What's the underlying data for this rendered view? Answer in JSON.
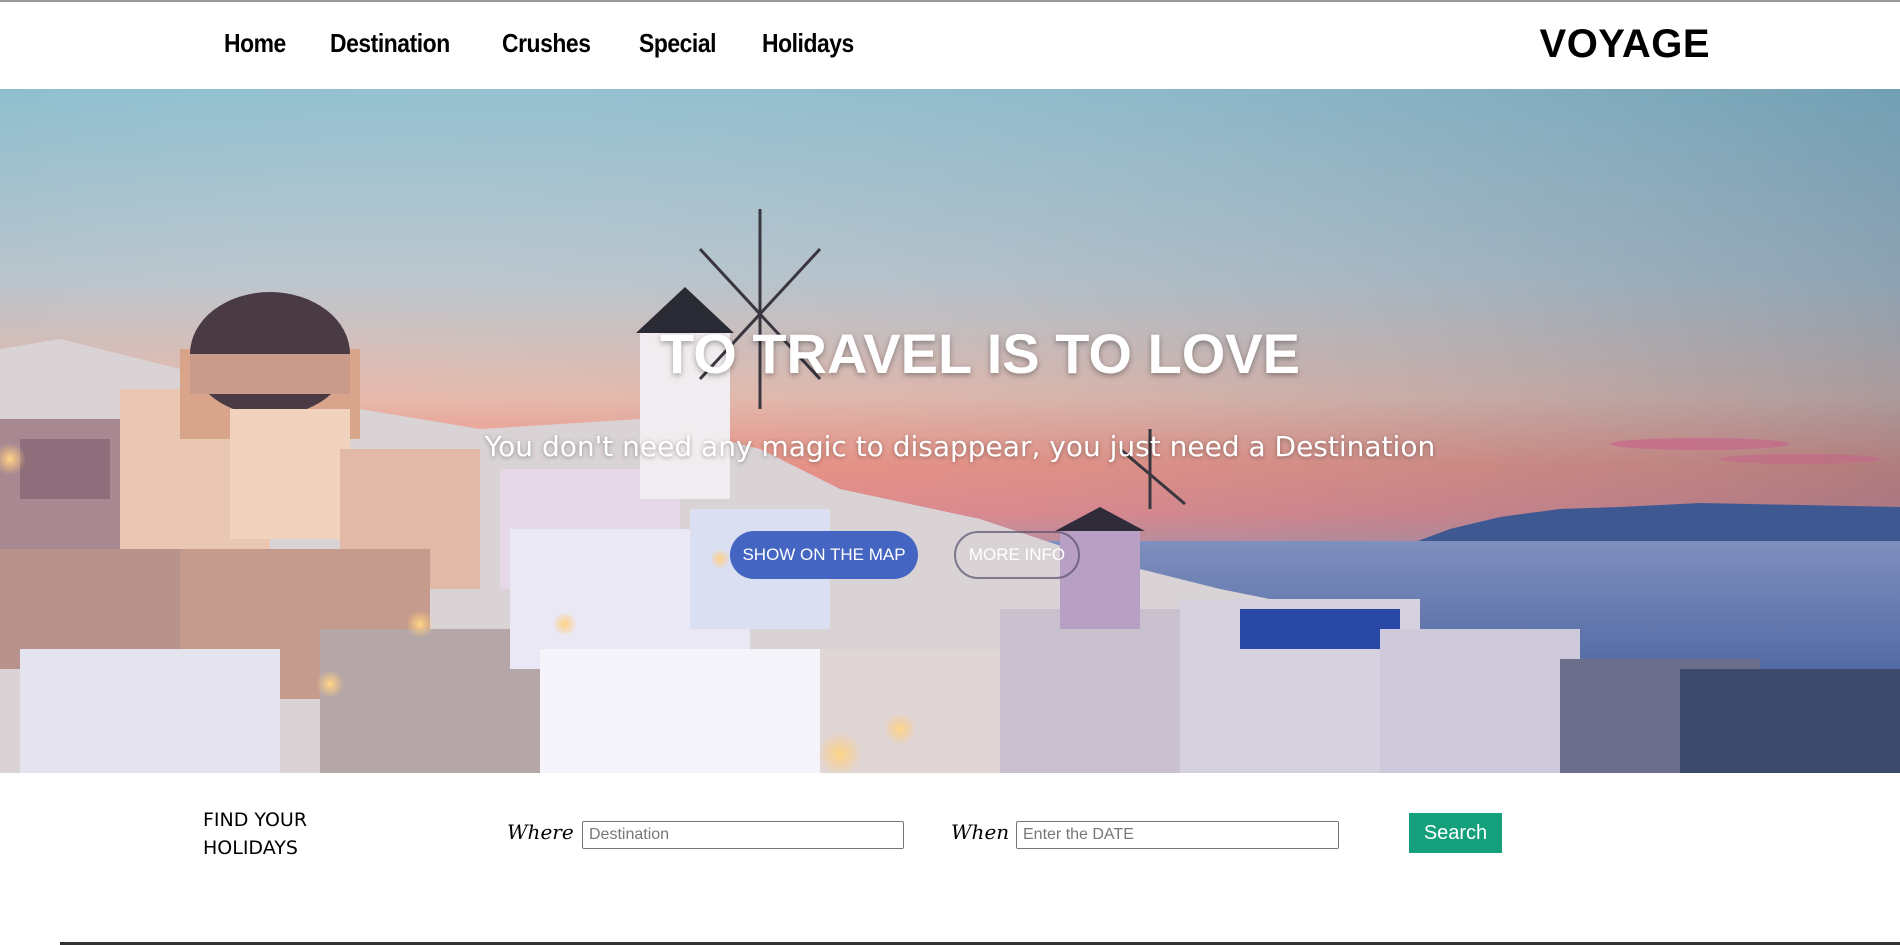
{
  "nav": {
    "items": [
      {
        "label": "Home"
      },
      {
        "label": "Destination"
      },
      {
        "label": "Crushes"
      },
      {
        "label": "Special"
      },
      {
        "label": "Holidays"
      }
    ],
    "brand": "VOYAGE"
  },
  "hero": {
    "title": "TO TRAVEL IS TO LOVE",
    "subtitle": "You don't need any magic to disappear, you just need a Destination",
    "buttons": {
      "map": "SHOW ON THE MAP",
      "info": "MORE INFO"
    }
  },
  "finder": {
    "label": "FIND YOUR HOLIDAYS",
    "where_label": "Where",
    "where_placeholder": "Destination",
    "when_label": "When",
    "when_placeholder": "Enter the DATE",
    "search_label": "Search"
  },
  "colors": {
    "accent_button": "#4565c2",
    "search_button": "#14a07c"
  }
}
